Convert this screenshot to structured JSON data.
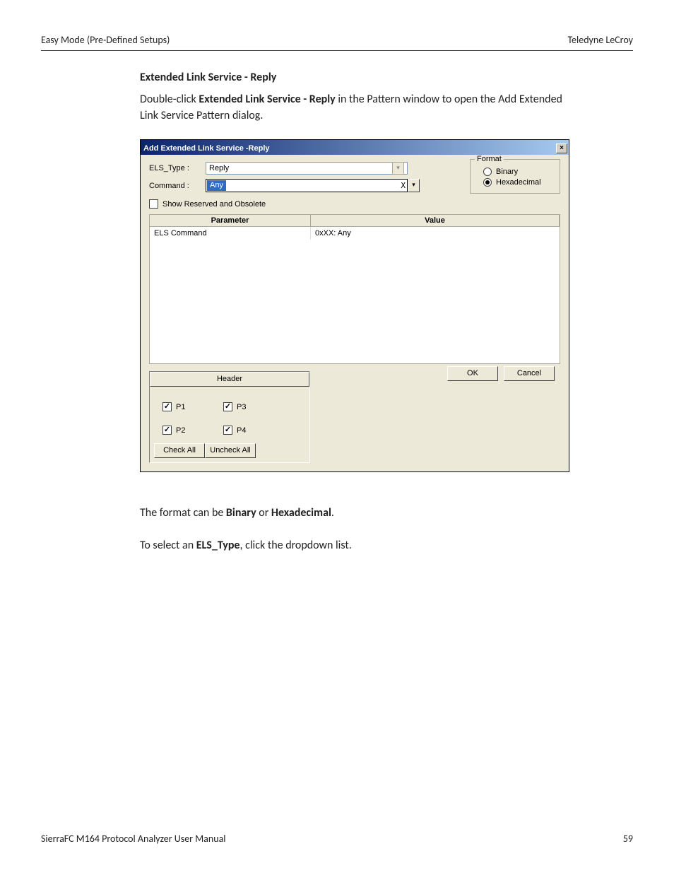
{
  "header": {
    "left": "Easy Mode (Pre-Defined Setups)",
    "right": "Teledyne LeCroy"
  },
  "section_title": "Extended Link Service - Reply",
  "intro": {
    "pre": "Double-click ",
    "bold": "Extended Link Service - Reply",
    "post": " in the Pattern window to open the Add Extended Link Service Pattern dialog."
  },
  "dialog": {
    "title": "Add Extended Link Service -Reply",
    "labels": {
      "els_type": "ELS_Type :",
      "command": "Command :"
    },
    "values": {
      "els_type": "Reply",
      "command_selected": "Any",
      "command_suffix": "X"
    },
    "show_reserved": "Show Reserved and Obsolete",
    "format": {
      "legend": "Format",
      "binary": "Binary",
      "hex": "Hexadecimal"
    },
    "grid": {
      "col_param": "Parameter",
      "col_value": "Value",
      "row_param": "ELS Command",
      "row_value": "0xXX: Any"
    },
    "header_btn": "Header",
    "ports": {
      "p1": "P1",
      "p2": "P2",
      "p3": "P3",
      "p4": "P4"
    },
    "check_all": "Check All",
    "uncheck_all": "Uncheck All",
    "ok": "OK",
    "cancel": "Cancel"
  },
  "after1": {
    "pre": "The format can be ",
    "b1": "Binary",
    "mid": " or ",
    "b2": "Hexadecimal",
    "post": "."
  },
  "after2": {
    "pre": "To select an ",
    "b1": "ELS_Type",
    "post": ", click the dropdown list."
  },
  "footer": {
    "left": "SierraFC M164 Protocol Analyzer User Manual",
    "right": "59"
  }
}
